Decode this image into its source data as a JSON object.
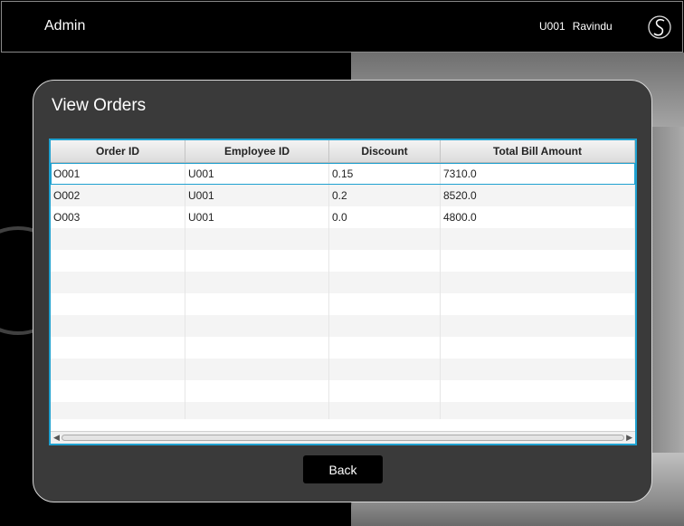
{
  "header": {
    "title": "Admin",
    "user_id": "U001",
    "user_name": "Ravindu",
    "logo_icon": "cs-logo-icon"
  },
  "panel": {
    "title": "View Orders"
  },
  "table": {
    "columns": [
      "Order ID",
      "Employee ID",
      "Discount",
      "Total Bill Amount"
    ],
    "rows": [
      [
        "O001",
        "U001",
        "0.15",
        "7310.0"
      ],
      [
        "O002",
        "U001",
        "0.2",
        "8520.0"
      ],
      [
        "O003",
        "U001",
        "0.0",
        "4800.0"
      ]
    ],
    "selected_row": 0
  },
  "actions": {
    "back_label": "Back"
  },
  "colors": {
    "accent": "#1fa1d0",
    "panel": "#3a3a3a",
    "background": "#000000"
  }
}
